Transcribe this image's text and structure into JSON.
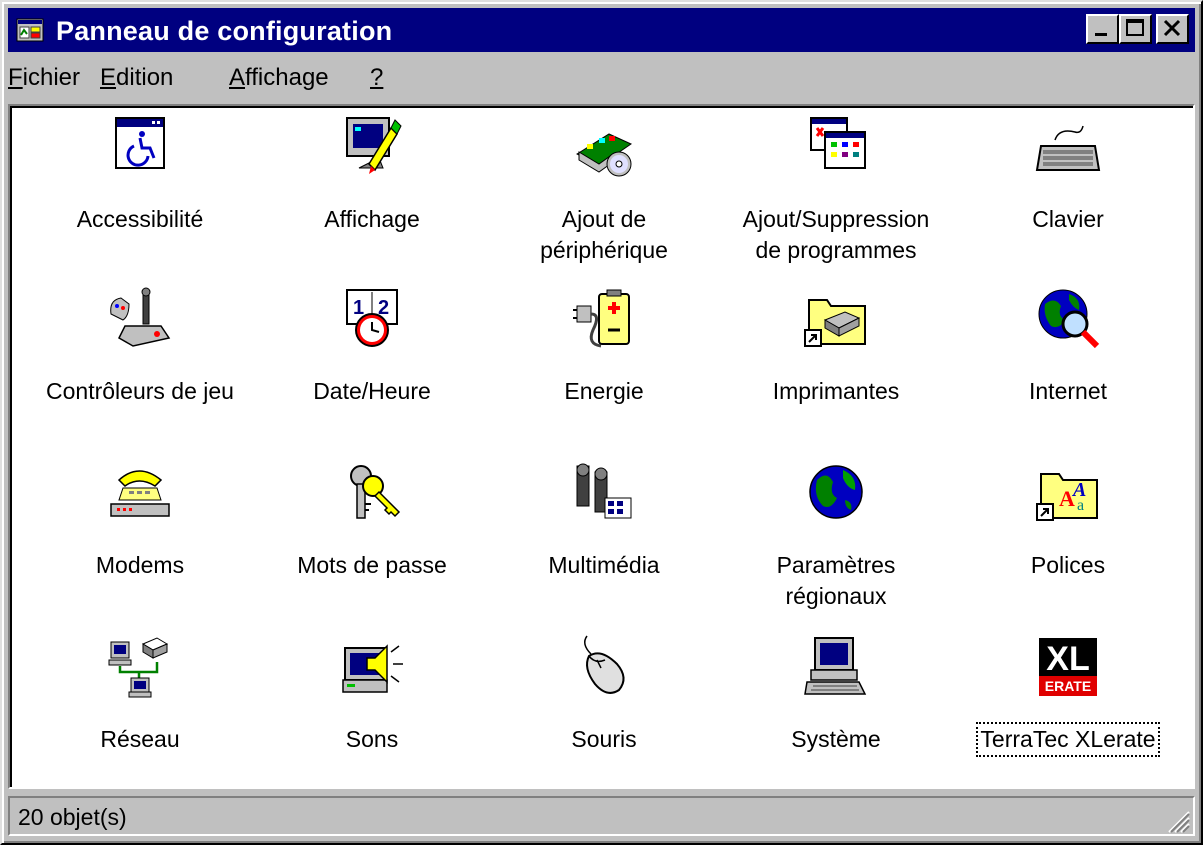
{
  "window": {
    "title": "Panneau de configuration"
  },
  "menu": [
    {
      "first": "F",
      "rest": "ichier"
    },
    {
      "first": "E",
      "rest": "dition"
    },
    {
      "first": "A",
      "rest": "ffichage"
    },
    {
      "first": "?",
      "rest": ""
    }
  ],
  "items": [
    {
      "label": "Accessibilité",
      "icon": "accessibility-icon"
    },
    {
      "label": "Affichage",
      "icon": "display-icon"
    },
    {
      "label": "Ajout de\npériphérique",
      "icon": "add-hardware-icon"
    },
    {
      "label": "Ajout/Suppression\nde programmes",
      "icon": "add-remove-programs-icon"
    },
    {
      "label": "Clavier",
      "icon": "keyboard-icon"
    },
    {
      "label": "Contrôleurs de jeu",
      "icon": "game-controller-icon"
    },
    {
      "label": "Date/Heure",
      "icon": "date-time-icon"
    },
    {
      "label": "Energie",
      "icon": "power-icon"
    },
    {
      "label": "Imprimantes",
      "icon": "printers-folder-icon"
    },
    {
      "label": "Internet",
      "icon": "internet-icon"
    },
    {
      "label": "Modems",
      "icon": "modem-icon"
    },
    {
      "label": "Mots de passe",
      "icon": "keys-icon"
    },
    {
      "label": "Multimédia",
      "icon": "multimedia-icon"
    },
    {
      "label": "Paramètres\nrégionaux",
      "icon": "globe-icon"
    },
    {
      "label": "Polices",
      "icon": "fonts-folder-icon"
    },
    {
      "label": "Réseau",
      "icon": "network-icon"
    },
    {
      "label": "Sons",
      "icon": "sounds-icon"
    },
    {
      "label": "Souris",
      "icon": "mouse-icon"
    },
    {
      "label": "Système",
      "icon": "system-icon"
    },
    {
      "label": "TerraTec XLerate",
      "icon": "xlerate-icon"
    }
  ],
  "xlerate_logo": {
    "top": "XL",
    "bottom": "ERATE"
  },
  "status": {
    "count_text": "20 objet(s)"
  },
  "colors": {
    "titlebar": "#000080",
    "face": "#c0c0c0",
    "content_bg": "#ffffff"
  }
}
